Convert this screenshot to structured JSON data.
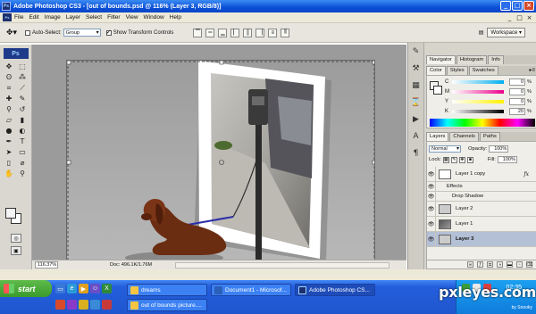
{
  "window": {
    "app_badge": "Ps",
    "title": "Adobe Photoshop CS3 - [out of bounds.psd @ 116% (Layer 3, RGB/8)]",
    "buttons": [
      "_",
      "□",
      "×"
    ]
  },
  "menubar": {
    "items": [
      "File",
      "Edit",
      "Image",
      "Layer",
      "Select",
      "Filter",
      "View",
      "Window",
      "Help"
    ],
    "doc_buttons": [
      "_",
      "□",
      "×"
    ]
  },
  "options": {
    "auto_select_label": "Auto-Select:",
    "auto_select_value": "Group",
    "show_transform_label": "Show Transform Controls",
    "workspace_label": "Workspace ▾"
  },
  "toolbox": {
    "logo": "Ps",
    "tools": [
      "move-icon",
      "marquee-icon",
      "lasso-icon",
      "magic-wand-icon",
      "crop-icon",
      "slice-icon",
      "healing-icon",
      "brush-icon",
      "stamp-icon",
      "history-brush-icon",
      "eraser-icon",
      "gradient-icon",
      "blur-icon",
      "dodge-icon",
      "pen-icon",
      "type-icon",
      "path-select-icon",
      "shape-icon",
      "notes-icon",
      "eyedropper-icon",
      "hand-icon",
      "zoom-icon"
    ],
    "foreground_color": "#f4f4f4",
    "background_color": "#ffffff"
  },
  "status": {
    "zoom": "116.37%",
    "doc_info": "Doc: 496.1K/1.76M"
  },
  "navigator_tabs": [
    "Navigator",
    "Histogram",
    "Info"
  ],
  "color_panel": {
    "tabs": [
      "Color",
      "Styles",
      "Swatches"
    ],
    "rows": [
      {
        "label": "C",
        "value": "0",
        "gradient": "linear-gradient(90deg,#fff,#00aeef)"
      },
      {
        "label": "M",
        "value": "0",
        "gradient": "linear-gradient(90deg,#fff,#ec008c)"
      },
      {
        "label": "Y",
        "value": "0",
        "gradient": "linear-gradient(90deg,#fff,#fff200)"
      },
      {
        "label": "K",
        "value": "20",
        "gradient": "linear-gradient(90deg,#fff,#000)"
      }
    ],
    "unit": "%"
  },
  "layers_panel": {
    "tabs": [
      "Layers",
      "Channels",
      "Paths"
    ],
    "blend_mode": "Normal",
    "opacity_label": "Opacity:",
    "opacity_value": "100%",
    "lock_label": "Lock:",
    "fill_label": "Fill:",
    "fill_value": "100%",
    "layers": [
      {
        "name": "Layer 1 copy",
        "thumb": "white",
        "fx": "fx",
        "selected": false
      },
      {
        "name": "Effects",
        "sub": true
      },
      {
        "name": "Drop Shadow",
        "sub": true
      },
      {
        "name": "Layer 2",
        "thumb": "gray",
        "selected": false
      },
      {
        "name": "Layer 1",
        "thumb": "dark",
        "selected": false
      },
      {
        "name": "Layer 3",
        "thumb": "gray",
        "selected": true
      }
    ]
  },
  "taskbar": {
    "start_label": "start",
    "tasks": [
      {
        "label": "dreams",
        "icon_color": "#f5c542"
      },
      {
        "label": "Document1 - Microsof...",
        "icon_color": "#2b5fb8"
      },
      {
        "label": "Adobe Photoshop CS...",
        "icon_color": "#1c2f6e"
      },
      {
        "label": "out of bounds picture....",
        "icon_color": "#f5c542"
      }
    ],
    "clock": "02:35"
  },
  "watermark": {
    "site": "pxleyes.com",
    "author": "by Snooky"
  }
}
